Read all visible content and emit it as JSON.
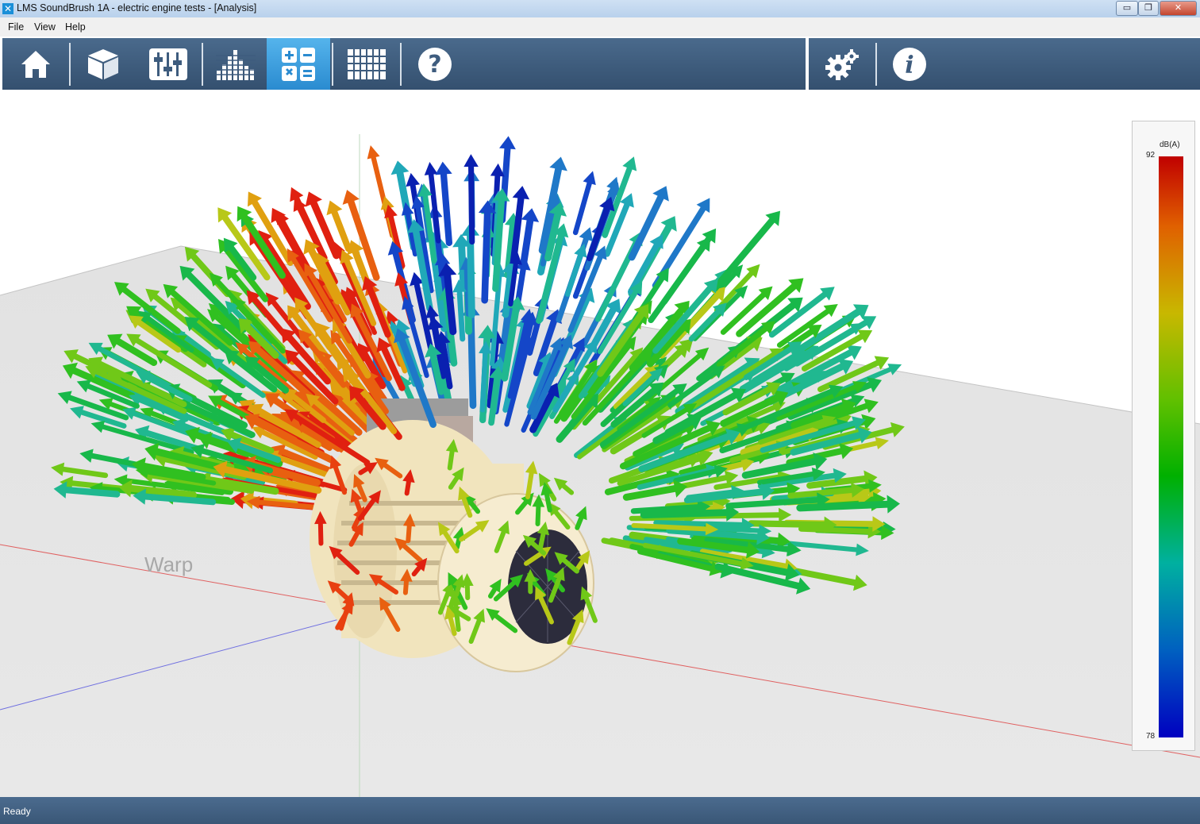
{
  "window": {
    "title": "LMS SoundBrush 1A - electric engine tests - [Analysis]",
    "app_icon_glyph": "✕",
    "minimize_glyph": "▭",
    "maximize_glyph": "❐",
    "close_glyph": "✕"
  },
  "menu": {
    "items": [
      "File",
      "View",
      "Help"
    ]
  },
  "toolbar": {
    "buttons": [
      {
        "icon": "home-icon",
        "active": false
      },
      {
        "icon": "cube-icon",
        "active": false
      },
      {
        "icon": "mixer-sliders-icon",
        "active": false
      },
      {
        "icon": "spectrum-bars-icon",
        "active": false
      },
      {
        "icon": "calculator-icon",
        "active": true
      },
      {
        "icon": "grid-table-icon",
        "active": false
      },
      {
        "icon": "help-icon",
        "active": false
      }
    ],
    "right_buttons": [
      {
        "icon": "gears-icon",
        "active": false
      },
      {
        "icon": "info-icon",
        "active": false
      }
    ],
    "active_color": "#2a8bd0",
    "bar_color": "#3e5c7e"
  },
  "viewport": {
    "floor_label": "Warp"
  },
  "legend": {
    "unit": "dB(A)",
    "max": "92",
    "min": "78",
    "colors": [
      "#c00000",
      "#e06000",
      "#c8b800",
      "#60c000",
      "#00b000",
      "#00b0a0",
      "#0060c0",
      "#0000c0"
    ]
  },
  "status": {
    "text": "Ready"
  }
}
